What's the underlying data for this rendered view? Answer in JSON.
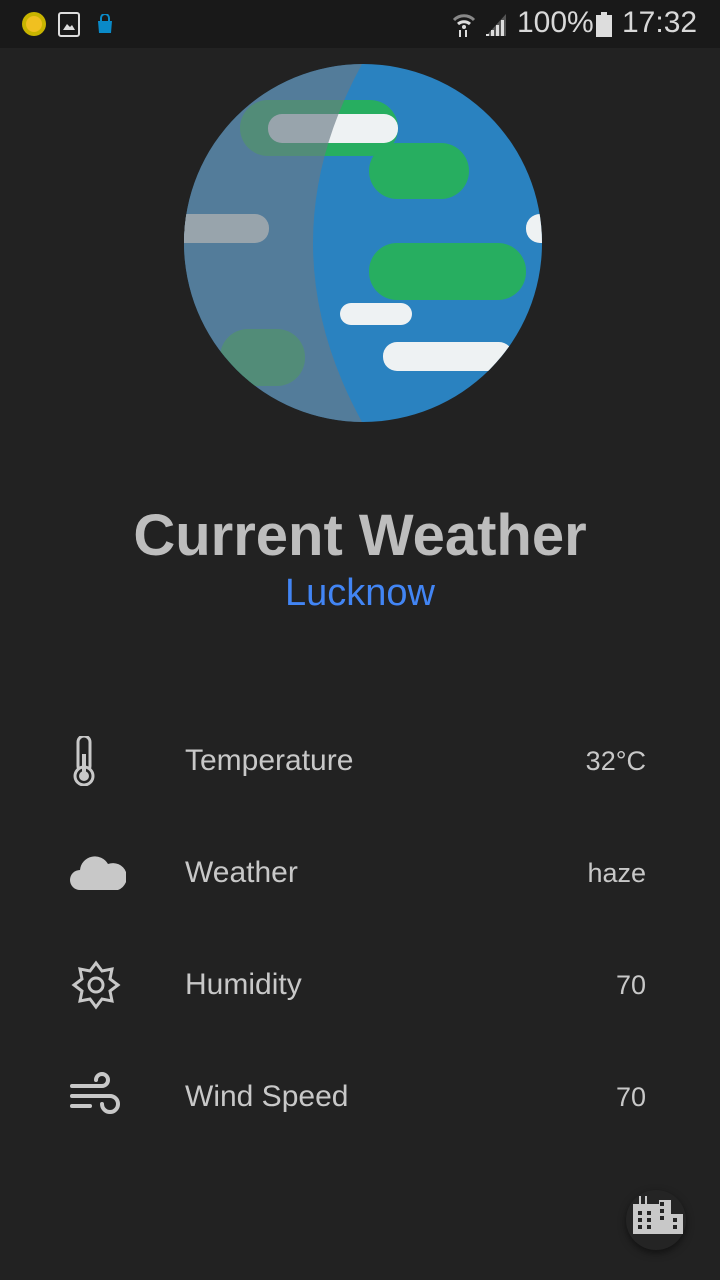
{
  "status_bar": {
    "battery": "100%",
    "time": "17:32",
    "icons": [
      "sun-icon",
      "gallery-icon",
      "shopping-bag-icon",
      "wifi-icon",
      "signal-icon",
      "battery-icon"
    ]
  },
  "header": {
    "title": "Current Weather",
    "city": "Lucknow"
  },
  "rows": [
    {
      "icon": "thermometer-icon",
      "label": "Temperature",
      "value": "32°C"
    },
    {
      "icon": "cloud-icon",
      "label": "Weather",
      "value": "haze"
    },
    {
      "icon": "gear-icon",
      "label": "Humidity",
      "value": "70"
    },
    {
      "icon": "wind-icon",
      "label": "Wind Speed",
      "value": "70"
    }
  ],
  "fab": {
    "icon": "city-building-icon"
  },
  "colors": {
    "accent": "#4285f4",
    "background": "#222222",
    "globe_blue": "#2a82c0",
    "cloud_green": "#27ae60"
  }
}
